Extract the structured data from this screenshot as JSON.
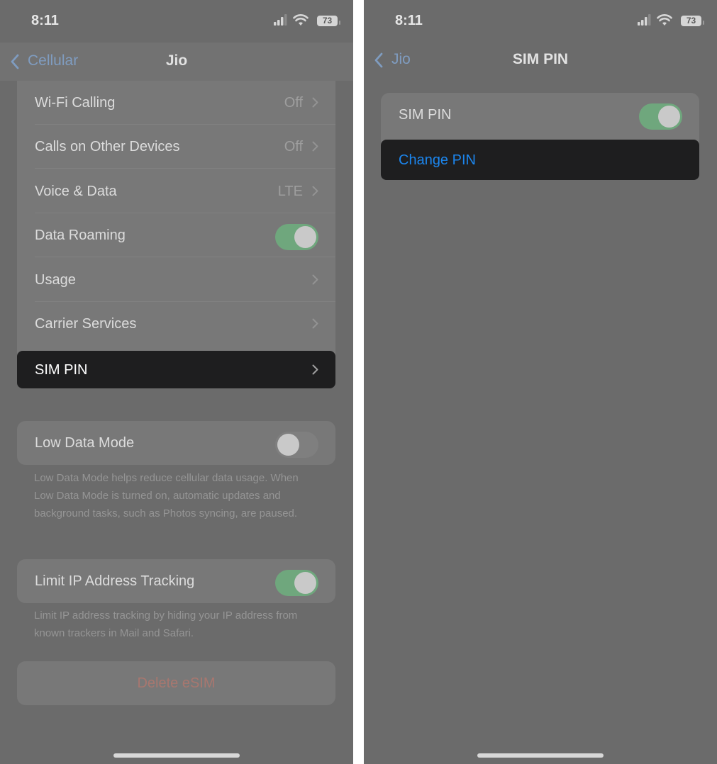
{
  "left_screen": {
    "status_bar": {
      "time": "8:11",
      "battery": "73"
    },
    "nav": {
      "back_label": "Cellular",
      "title": "Jio"
    },
    "rows": [
      {
        "label": "Wi-Fi Calling",
        "value": "Off"
      },
      {
        "label": "Calls on Other Devices",
        "value": "Off"
      },
      {
        "label": "Voice & Data",
        "value": "LTE"
      },
      {
        "label": "Data Roaming",
        "toggle": "on"
      },
      {
        "label": "Usage"
      },
      {
        "label": "Carrier Services"
      },
      {
        "label": "SIM PIN",
        "highlighted": true
      }
    ],
    "low_data_mode": {
      "label": "Low Data Mode",
      "toggle": "off",
      "footer": "Low Data Mode helps reduce cellular data usage. When Low Data Mode is turned on, automatic updates and background tasks, such as Photos syncing, are paused."
    },
    "limit_ip": {
      "label": "Limit IP Address Tracking",
      "toggle": "on",
      "footer": "Limit IP address tracking by hiding your IP address from known trackers in Mail and Safari."
    },
    "delete_esim": {
      "label": "Delete eSIM"
    }
  },
  "right_screen": {
    "status_bar": {
      "time": "8:11",
      "battery": "73"
    },
    "nav": {
      "back_label": "Jio",
      "title": "SIM PIN"
    },
    "sim_pin": {
      "label": "SIM PIN",
      "toggle": "on"
    },
    "change_pin": {
      "label": "Change PIN",
      "highlighted": true
    }
  },
  "colors": {
    "screen_bg": "#6b6b6b",
    "toggle_on": "#6fa77d",
    "link_blue": "#1c86ee",
    "destructive": "#a8776f",
    "highlight_bg": "#1e1e1f"
  }
}
